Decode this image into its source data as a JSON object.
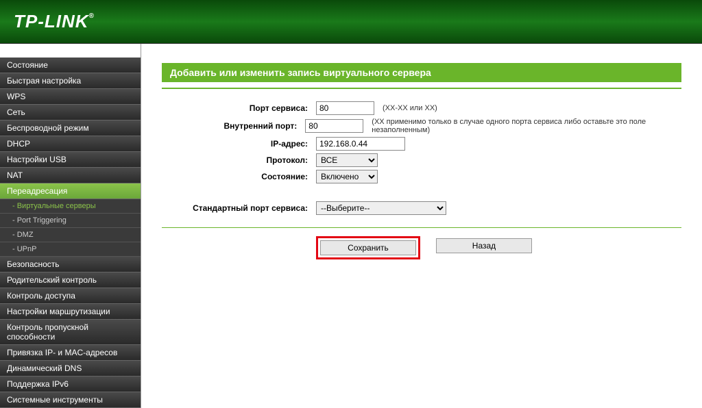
{
  "brand": "TP-LINK",
  "sidebar": {
    "items": [
      {
        "label": "Состояние",
        "type": "item"
      },
      {
        "label": "Быстрая настройка",
        "type": "item"
      },
      {
        "label": "WPS",
        "type": "item"
      },
      {
        "label": "Сеть",
        "type": "item"
      },
      {
        "label": "Беспроводной режим",
        "type": "item"
      },
      {
        "label": "DHCP",
        "type": "item"
      },
      {
        "label": "Настройки USB",
        "type": "item"
      },
      {
        "label": "NAT",
        "type": "item"
      },
      {
        "label": "Переадресация",
        "type": "item",
        "active": true
      },
      {
        "label": "- Виртуальные серверы",
        "type": "sub",
        "active": true
      },
      {
        "label": "- Port Triggering",
        "type": "sub"
      },
      {
        "label": "- DMZ",
        "type": "sub"
      },
      {
        "label": "- UPnP",
        "type": "sub"
      },
      {
        "label": "Безопасность",
        "type": "item"
      },
      {
        "label": "Родительский контроль",
        "type": "item"
      },
      {
        "label": "Контроль доступа",
        "type": "item"
      },
      {
        "label": "Настройки маршрутизации",
        "type": "item"
      },
      {
        "label": "Контроль пропускной способности",
        "type": "item"
      },
      {
        "label": "Привязка IP- и MAC-адресов",
        "type": "item"
      },
      {
        "label": "Динамический DNS",
        "type": "item"
      },
      {
        "label": "Поддержка IPv6",
        "type": "item"
      },
      {
        "label": "Системные инструменты",
        "type": "item"
      }
    ]
  },
  "page": {
    "title": "Добавить или изменить запись виртуального сервера",
    "form": {
      "service_port_label": "Порт сервиса:",
      "service_port_value": "80",
      "service_port_help": "(XX-XX или XX)",
      "internal_port_label": "Внутренний порт:",
      "internal_port_value": "80",
      "internal_port_help": "(XX применимо только в случае одного порта сервиса либо оставьте это поле незаполненным)",
      "ip_label": "IP-адрес:",
      "ip_value": "192.168.0.44",
      "protocol_label": "Протокол:",
      "protocol_value": "ВСЕ",
      "state_label": "Состояние:",
      "state_value": "Включено",
      "std_port_label": "Стандартный порт сервиса:",
      "std_port_value": "--Выберите--"
    },
    "buttons": {
      "save": "Сохранить",
      "back": "Назад"
    }
  }
}
